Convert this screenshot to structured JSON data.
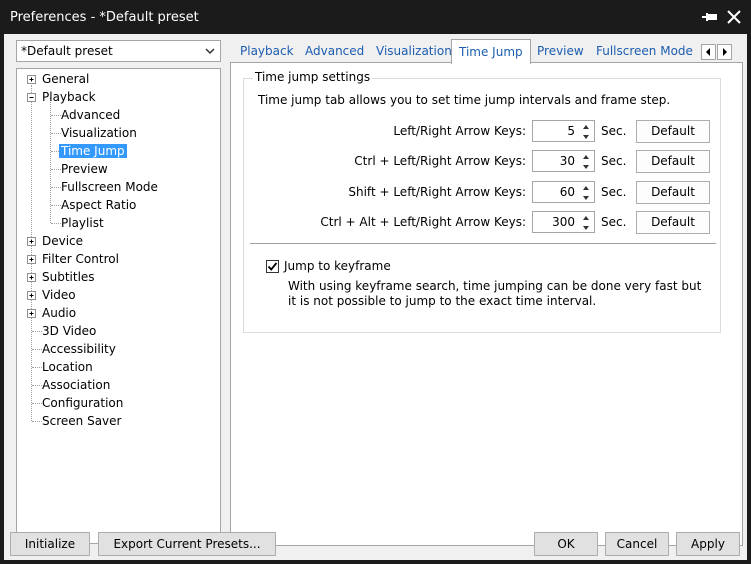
{
  "window": {
    "title": "Preferences - *Default preset"
  },
  "preset": {
    "value": "*Default preset"
  },
  "tree": {
    "general": "General",
    "playback": "Playback",
    "advanced": "Advanced",
    "visualization": "Visualization",
    "time_jump": "Time Jump",
    "preview": "Preview",
    "fullscreen_mode": "Fullscreen Mode",
    "aspect_ratio": "Aspect Ratio",
    "playlist": "Playlist",
    "device": "Device",
    "filter_control": "Filter Control",
    "subtitles": "Subtitles",
    "video": "Video",
    "audio": "Audio",
    "video_3d": "3D Video",
    "accessibility": "Accessibility",
    "location": "Location",
    "association": "Association",
    "configuration": "Configuration",
    "screen_saver": "Screen Saver"
  },
  "tabs": {
    "playback": "Playback",
    "advanced": "Advanced",
    "visualization": "Visualization",
    "time_jump": "Time Jump",
    "preview": "Preview",
    "fullscreen": "Fullscreen Mode"
  },
  "timejump": {
    "group_title": "Time jump settings",
    "description": "Time jump tab allows you to set time jump intervals and frame step.",
    "rows": [
      {
        "label": "Left/Right Arrow Keys:",
        "value": "5",
        "unit": "Sec.",
        "button": "Default"
      },
      {
        "label": "Ctrl + Left/Right Arrow Keys:",
        "value": "30",
        "unit": "Sec.",
        "button": "Default"
      },
      {
        "label": "Shift + Left/Right Arrow Keys:",
        "value": "60",
        "unit": "Sec.",
        "button": "Default"
      },
      {
        "label": "Ctrl + Alt + Left/Right Arrow Keys:",
        "value": "300",
        "unit": "Sec.",
        "button": "Default"
      }
    ],
    "keyframe_label": "Jump to keyframe",
    "keyframe_checked": true,
    "keyframe_desc": "With using keyframe search, time jumping can be done very fast but it is not possible to jump to the exact time interval."
  },
  "footer": {
    "initialize": "Initialize",
    "export": "Export Current Presets...",
    "ok": "OK",
    "cancel": "Cancel",
    "apply": "Apply"
  },
  "colors": {
    "selection": "#3399ff",
    "tab_text": "#1c5db0",
    "titlebar": "#1b1b1b"
  }
}
